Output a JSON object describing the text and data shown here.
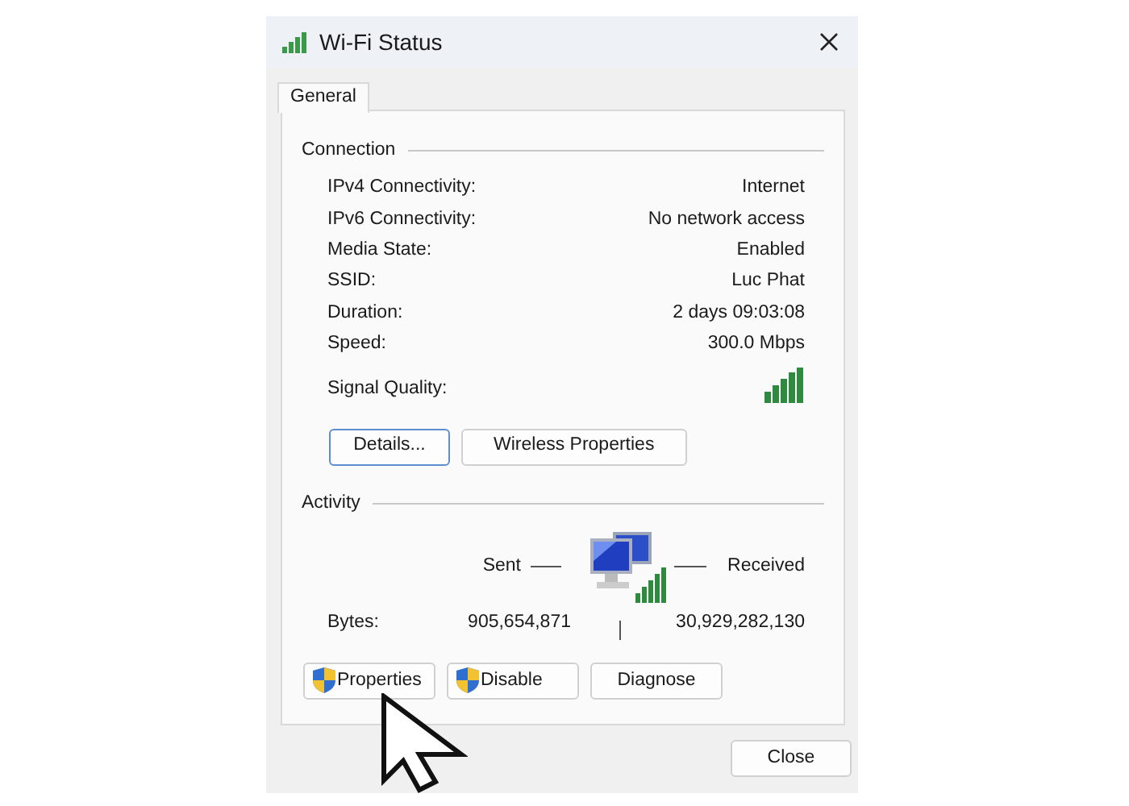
{
  "window": {
    "title": "Wi-Fi Status"
  },
  "tabs": [
    {
      "label": "General",
      "selected": true
    }
  ],
  "connection": {
    "heading": "Connection",
    "rows": [
      {
        "label": "IPv4 Connectivity:",
        "value": "Internet"
      },
      {
        "label": "IPv6 Connectivity:",
        "value": "No network access"
      },
      {
        "label": "Media State:",
        "value": "Enabled"
      },
      {
        "label": "SSID:",
        "value": "Luc Phat"
      },
      {
        "label": "Duration:",
        "value": "2 days 09:03:08"
      },
      {
        "label": "Speed:",
        "value": "300.0 Mbps"
      }
    ],
    "signal_label": "Signal Quality:",
    "buttons": [
      {
        "label": "Details...",
        "focused": true
      },
      {
        "label": "Wireless Properties",
        "focused": false
      }
    ]
  },
  "activity": {
    "heading": "Activity",
    "sent_label": "Sent",
    "received_label": "Received",
    "bytes_label": "Bytes:",
    "sent_bytes": "905,654,871",
    "received_bytes": "30,929,282,130"
  },
  "action_buttons": [
    {
      "label": "Properties",
      "kind": "shield"
    },
    {
      "label": "Disable",
      "kind": "shield"
    },
    {
      "label": "Diagnose",
      "kind": "plain"
    }
  ],
  "close_button": "Close"
}
